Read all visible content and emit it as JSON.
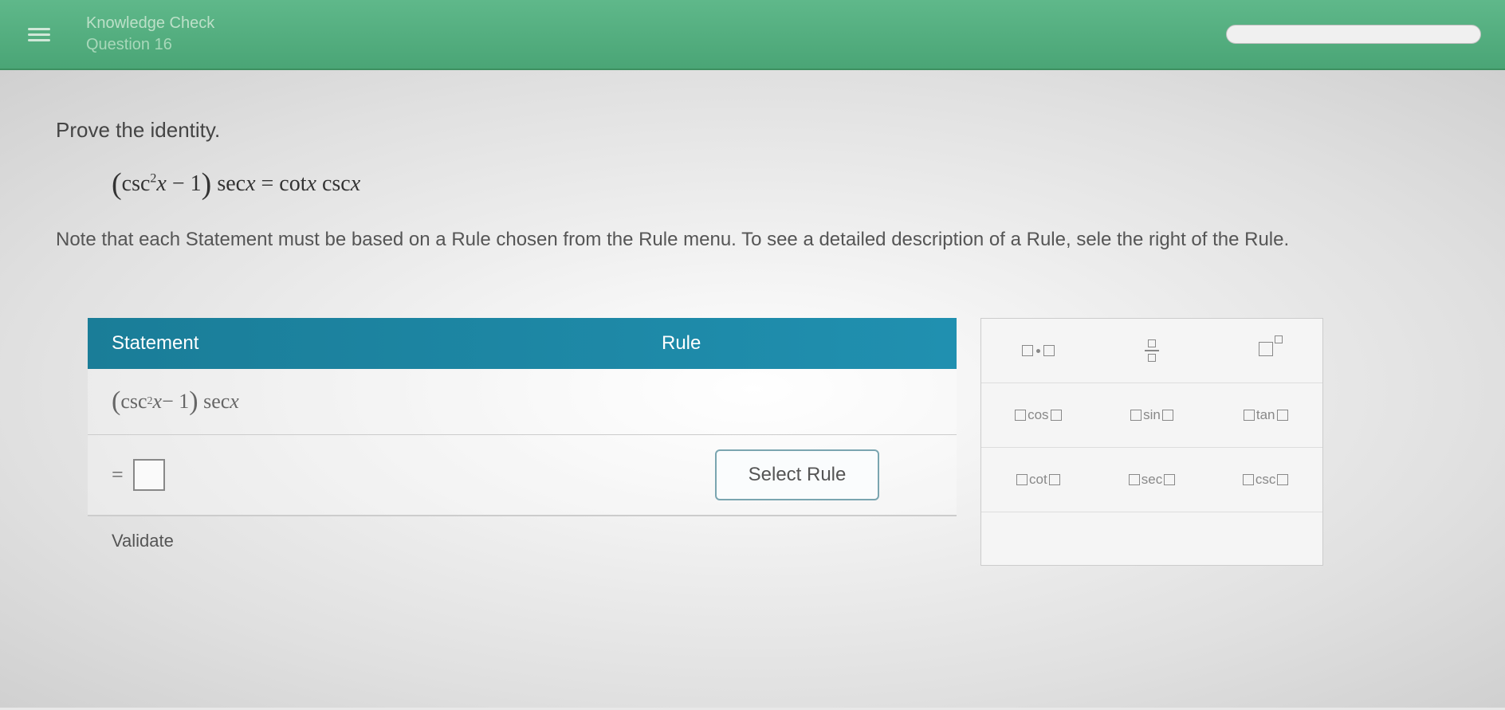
{
  "header": {
    "title": "Knowledge Check",
    "subtitle": "Question 16"
  },
  "content": {
    "prompt": "Prove the identity.",
    "equation_html": "(csc²x − 1) secx = cotx cscx",
    "note": "Note that each Statement must be based on a Rule chosen from the Rule menu. To see a detailed description of a Rule, sele the right of the Rule."
  },
  "proof": {
    "header_statement": "Statement",
    "header_rule": "Rule",
    "rows": [
      {
        "statement_html": "(csc²x − 1) secx",
        "rule": ""
      },
      {
        "statement_prefix": "=",
        "input": true,
        "rule_button": "Select Rule"
      }
    ],
    "validate": "Validate"
  },
  "palette": {
    "trig": {
      "cos": "cos",
      "sin": "sin",
      "tan": "tan",
      "cot": "cot",
      "sec": "sec",
      "csc": "csc"
    }
  }
}
